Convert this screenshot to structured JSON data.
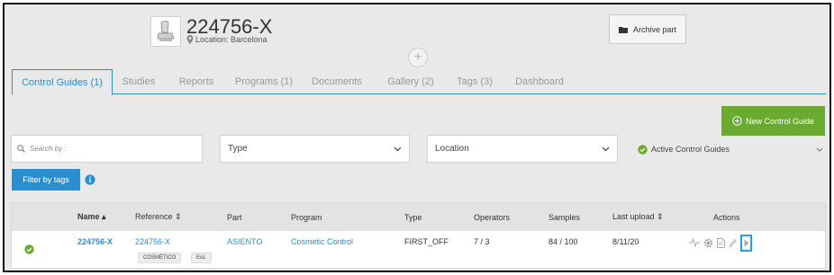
{
  "header": {
    "part_id": "224756-X",
    "location_label": "Location: Barcelona",
    "archive_label": "Archive part"
  },
  "tabs": [
    {
      "label": "Control Guides (1)"
    },
    {
      "label": "Studies"
    },
    {
      "label": "Reports"
    },
    {
      "label": "Programs (1)"
    },
    {
      "label": "Documents"
    },
    {
      "label": "Gallery (2)"
    },
    {
      "label": "Tags (3)"
    },
    {
      "label": "Dashboard"
    }
  ],
  "toolbar": {
    "new_cg_label": "New Control Guide",
    "search_placeholder": "Search by :",
    "type_select": "Type",
    "location_select": "Location",
    "active_cg_label": "Active Control Guides",
    "filter_tags_label": "Filter by tags"
  },
  "table": {
    "headers": {
      "name": "Name ▴",
      "reference": "Reference ⇕",
      "part": "Part",
      "program": "Program",
      "type": "Type",
      "operators": "Operators",
      "samples": "Samples",
      "last_upload": "Last upload ⇕",
      "actions": "Actions"
    },
    "rows": [
      {
        "name": "224756-X",
        "reference": "224756-X",
        "tags": [
          "COSMÉTICO",
          "EoL"
        ],
        "part": "ASIENTO",
        "program": "Cosmetic Control",
        "type": "FIRST_OFF",
        "operators": "7 / 3",
        "samples": "84 / 100",
        "last_upload": "8/11/20"
      }
    ]
  },
  "colors": {
    "accent": "#2a8fd0",
    "success": "#6aaa2e"
  }
}
